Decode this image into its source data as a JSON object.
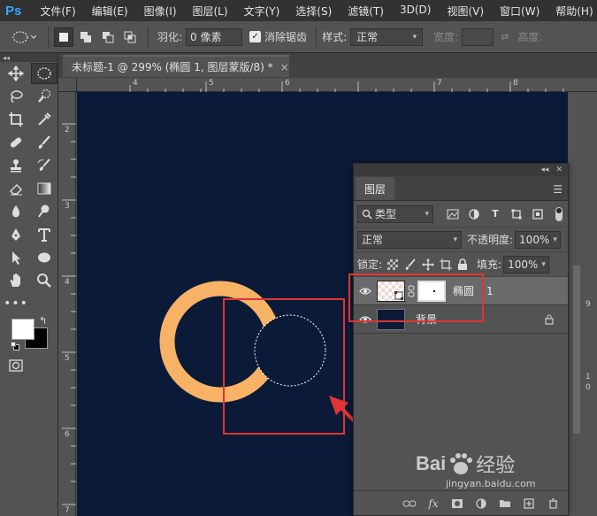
{
  "app": {
    "logo": "Ps",
    "menu": [
      "文件(F)",
      "编辑(E)",
      "图像(I)",
      "图层(L)",
      "文字(Y)",
      "选择(S)",
      "滤镜(T)",
      "3D(D)",
      "视图(V)",
      "窗口(W)",
      "帮助(H)"
    ]
  },
  "options": {
    "feather_label": "羽化:",
    "feather_value": "0 像素",
    "antialias_label": "消除锯齿",
    "style_label": "样式:",
    "style_value": "正常",
    "width_label": "宽度:",
    "height_label": "高度:"
  },
  "document": {
    "tab_title": "未标题-1 @ 299% (椭圆 1, 图层蒙版/8) *",
    "close": "×"
  },
  "rulers": {
    "top": [
      "4",
      "5",
      "6",
      "7",
      "8"
    ],
    "left": [
      "2",
      "3",
      "4",
      "5",
      "6",
      "7"
    ],
    "right_side": [
      "9",
      "1",
      "0"
    ]
  },
  "layers_panel": {
    "tab": "图层",
    "filter_label": "类型",
    "blend_mode": "正常",
    "opacity_label": "不透明度:",
    "opacity_value": "100%",
    "lock_label": "锁定:",
    "fill_label": "填充:",
    "fill_value": "100%",
    "layers": [
      {
        "name": "椭圆",
        "suffix": "1",
        "selected": true
      },
      {
        "name": "背景",
        "selected": false
      }
    ],
    "bottom_fx": "fx"
  },
  "watermark": {
    "brand": "Bai",
    "brand_tail": "经验",
    "url": "jingyan.baidu.com"
  },
  "colors": {
    "canvas_bg": "#0b1b37",
    "ring": "#f7b266",
    "highlight": "#e13434"
  }
}
